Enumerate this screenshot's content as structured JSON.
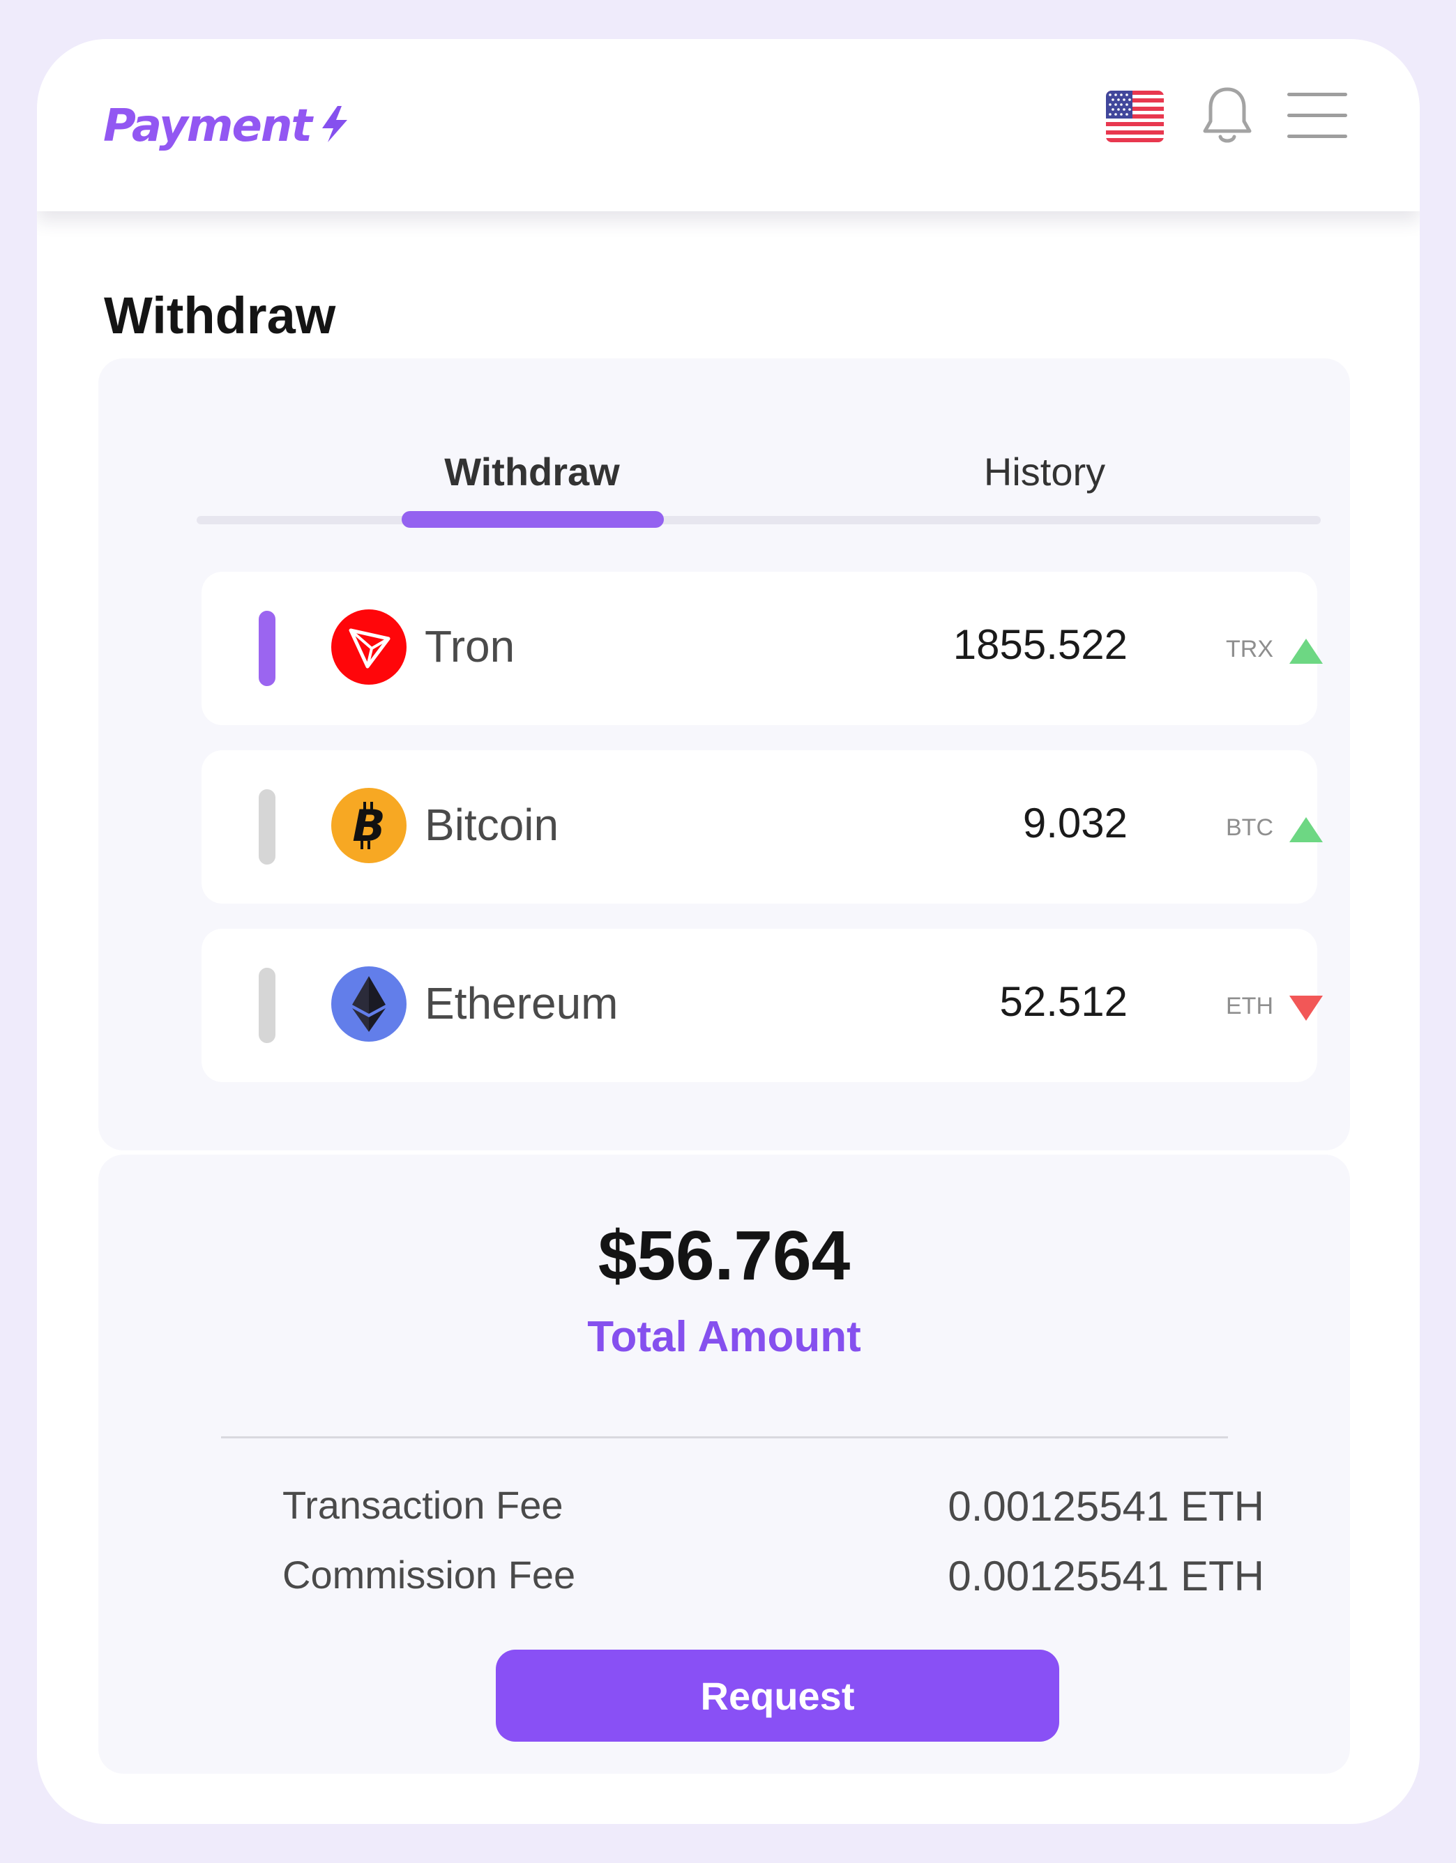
{
  "header": {
    "logo_text": "Payment",
    "flag_icon": "us-flag-icon",
    "bell_icon": "bell-icon",
    "menu_icon": "hamburger-menu-icon"
  },
  "page": {
    "title": "Withdraw"
  },
  "tabs": [
    {
      "label": "Withdraw",
      "active": true
    },
    {
      "label": "History",
      "active": false
    }
  ],
  "assets": [
    {
      "name": "Tron",
      "amount": "1855.522",
      "symbol": "TRX",
      "trend": "up",
      "selected": true,
      "icon": "tron-icon",
      "color": "#ff060a"
    },
    {
      "name": "Bitcoin",
      "amount": "9.032",
      "symbol": "BTC",
      "trend": "up",
      "selected": false,
      "icon": "bitcoin-icon",
      "color": "#f7a823"
    },
    {
      "name": "Ethereum",
      "amount": "52.512",
      "symbol": "ETH",
      "trend": "down",
      "selected": false,
      "icon": "ethereum-icon",
      "color": "#627eea"
    }
  ],
  "summary": {
    "total_value": "$56.764",
    "total_label": "Total Amount",
    "fees": [
      {
        "label": "Transaction Fee",
        "value": "0.00125541 ETH"
      },
      {
        "label": "Commission Fee",
        "value": "0.00125541 ETH"
      }
    ],
    "request_label": "Request"
  },
  "colors": {
    "accent": "#8950f5",
    "trend_up": "#6dd783",
    "trend_down": "#f25757",
    "background": "#efebfb"
  }
}
